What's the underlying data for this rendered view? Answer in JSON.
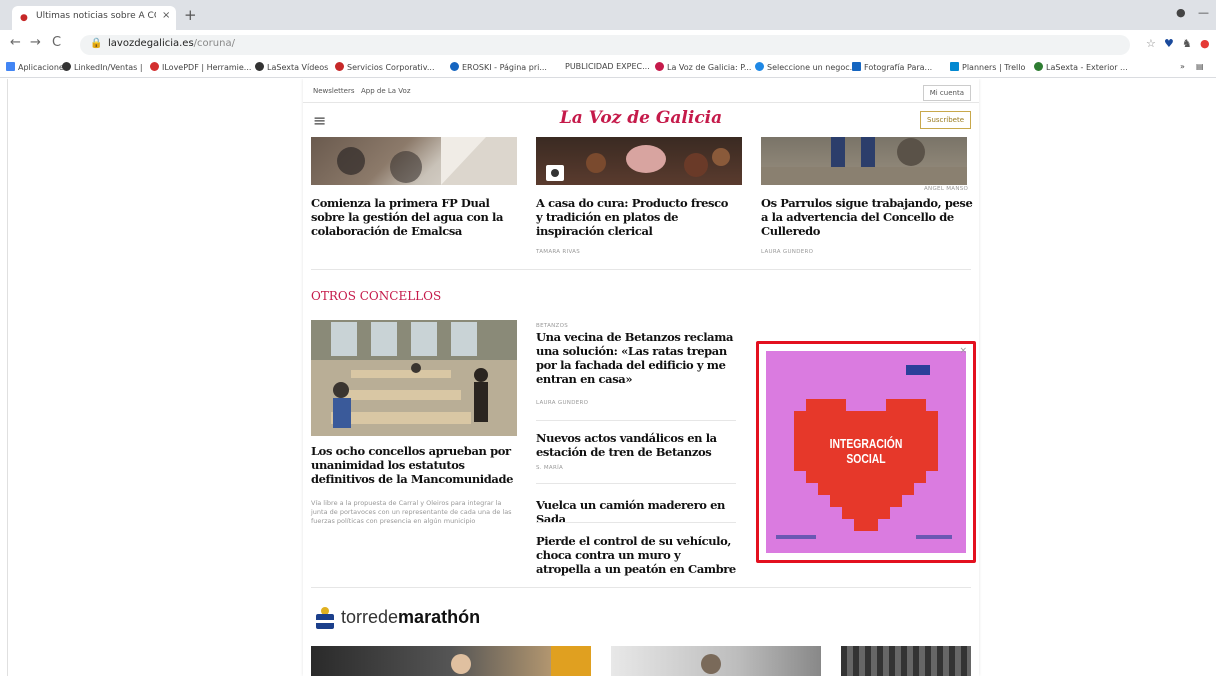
{
  "browser": {
    "tab_title": "Últimas noticias sobre A CORUÑA",
    "tab_close": "×",
    "new_tab": "+",
    "url_host": "lavozdegalicia.es",
    "url_path": "/coruna/",
    "back": "←",
    "forward": "→",
    "reload": "C",
    "menu": "⋮",
    "minimize": "—",
    "bookmarks": [
      {
        "label": "Aplicaciones",
        "color": "#4285f4"
      },
      {
        "label": "LinkedIn/Ventas |",
        "color": "#333333"
      },
      {
        "label": "ILovePDF | Herramie...",
        "color": "#d32f2f"
      },
      {
        "label": "LaSexta Vídeos",
        "color": "#333333"
      },
      {
        "label": "Servicios Corporativ...",
        "color": "#c62828"
      },
      {
        "label": "EROSKI - Página pri...",
        "color": "#1565c0"
      },
      {
        "label": "PUBLICIDAD EXPEC...",
        "color": "#888888"
      },
      {
        "label": "La Voz de Galicia: P...",
        "color": "#c51a4a"
      },
      {
        "label": "Seleccione un negoc...",
        "color": "#1e88e5"
      },
      {
        "label": "Fotografía Para...",
        "color": "#1565c0"
      },
      {
        "label": "Planners | Trello",
        "color": "#0288d1"
      },
      {
        "label": "LaSexta - Exterior ...",
        "color": "#2e7d32"
      }
    ]
  },
  "site": {
    "top_links": [
      "Newsletters",
      "App de La Voz"
    ],
    "account_label": "Mi cuenta",
    "logo": "La Voz de Galicia",
    "subscribe_label": "Suscríbete",
    "menu_icon": "≡"
  },
  "top_cards": [
    {
      "title": "Comienza la primera FP Dual sobre la gestión del agua con la colaboración de Emalcsa",
      "byline": ""
    },
    {
      "title": "A casa do cura: Producto fresco y tradición en platos de inspiración clerical",
      "byline": "TAMARA RIVAS"
    },
    {
      "title": "Os Parrulos sigue trabajando, pese a la advertencia del Concello de Culleredo",
      "byline": "LAURA GUNDERO",
      "photo_credit": "ANGEL MANSO"
    }
  ],
  "section": {
    "title": "OTROS CONCELLOS"
  },
  "lead_story": {
    "title": "Los ocho concellos aprueban por unanimidad los estatutos definitivos de la Mancomunidade",
    "desc": "Vía libre a la propuesta de Carral y Oleiros para integrar la junta de portavoces con un representante de cada una de las fuerzas políticas con presencia en algún municipio"
  },
  "side_stories": [
    {
      "kicker": "BETANZOS",
      "title": "Una vecina de Betanzos reclama una solución: «Las ratas trepan por la fachada del edificio y me entran en casa»",
      "byline": "LAURA GUNDERO"
    },
    {
      "title": "Nuevos actos vandálicos en la estación de tren de Betanzos",
      "byline": "S. MARÍA"
    },
    {
      "title": "Vuelca un camión maderero en Sada",
      "byline": ""
    },
    {
      "title": "Pierde el control de su vehículo, choca contra un muro y atropella a un peatón en Cambre",
      "byline": ""
    }
  ],
  "ad": {
    "text_line1": "INTEGRACIÓN",
    "text_line2": "SOCIAL",
    "close": "×"
  },
  "brand_block": {
    "prefix": "torrede",
    "suffix": "marathón"
  }
}
